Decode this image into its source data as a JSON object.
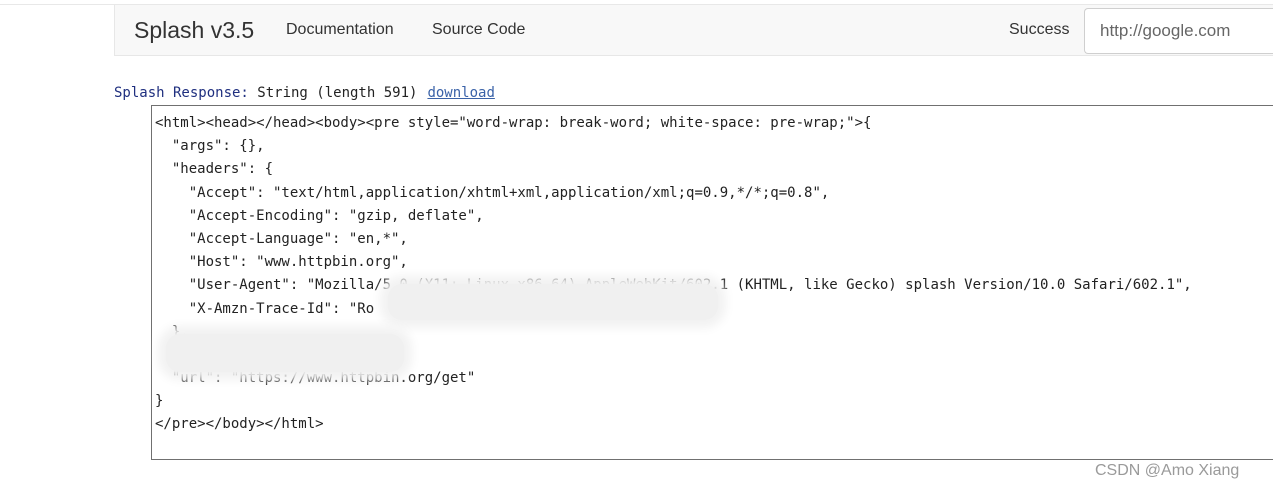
{
  "navbar": {
    "brand": "Splash v3.5",
    "links": [
      "Documentation",
      "Source Code"
    ],
    "status": "Success",
    "url_placeholder": "http://google.com"
  },
  "response": {
    "label": "Splash Response:",
    "type_text": " String (length 591)",
    "download_label": "download"
  },
  "code_lines": [
    "<html><head></head><body><pre style=\"word-wrap: break-word; white-space: pre-wrap;\">{",
    "  \"args\": {},",
    "  \"headers\": {",
    "    \"Accept\": \"text/html,application/xhtml+xml,application/xml;q=0.9,*/*;q=0.8\",",
    "    \"Accept-Encoding\": \"gzip, deflate\",",
    "    \"Accept-Language\": \"en,*\",",
    "    \"Host\": \"www.httpbin.org\",",
    "    \"User-Agent\": \"Mozilla/5.0 (X11; Linux x86_64) AppleWebKit/602.1 (KHTML, like Gecko) splash Version/10.0 Safari/602.1\",",
    "    \"X-Amzn-Trace-Id\": \"Ro                                      f\"",
    "  },",
    "  ",
    "  \"url\": \"https://www.httpbin.org/get\"",
    "}",
    "</pre></body></html>"
  ],
  "watermark": "CSDN @Amo Xiang"
}
